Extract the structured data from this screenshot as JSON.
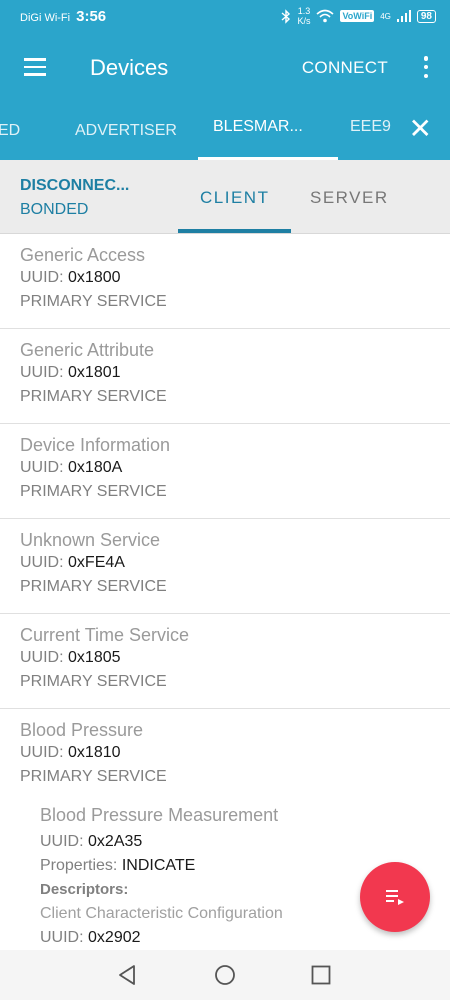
{
  "status_bar": {
    "carrier": "DiGi Wi-Fi",
    "time": "3:56",
    "speed_value": "1.3",
    "speed_unit": "K/s",
    "vowifi": "VoWiFi",
    "network": "4G",
    "battery": "98"
  },
  "app_bar": {
    "title": "Devices",
    "connect_label": "CONNECT"
  },
  "tabs": {
    "items": [
      "ED",
      "ADVERTISER",
      "BLESMAR...",
      "EEE9"
    ],
    "active_index": 2
  },
  "device": {
    "state": "DISCONNEC...",
    "bond": "BONDED"
  },
  "subtabs": {
    "client": "CLIENT",
    "server": "SERVER"
  },
  "services": [
    {
      "name": "Generic Access",
      "uuid_label": "UUID:",
      "uuid": "0x1800",
      "type": "PRIMARY SERVICE"
    },
    {
      "name": "Generic Attribute",
      "uuid_label": "UUID:",
      "uuid": "0x1801",
      "type": "PRIMARY SERVICE"
    },
    {
      "name": "Device Information",
      "uuid_label": "UUID:",
      "uuid": "0x180A",
      "type": "PRIMARY SERVICE"
    },
    {
      "name": "Unknown Service",
      "uuid_label": "UUID:",
      "uuid": "0xFE4A",
      "type": "PRIMARY SERVICE"
    },
    {
      "name": "Current Time Service",
      "uuid_label": "UUID:",
      "uuid": "0x1805",
      "type": "PRIMARY SERVICE"
    },
    {
      "name": "Blood Pressure",
      "uuid_label": "UUID:",
      "uuid": "0x1810",
      "type": "PRIMARY SERVICE"
    }
  ],
  "characteristic": {
    "name": "Blood Pressure Measurement",
    "uuid_label": "UUID:",
    "uuid": "0x2A35",
    "properties_label": "Properties:",
    "properties": "INDICATE",
    "descriptors_label": "Descriptors:",
    "descriptor_name": "Client Characteristic Configuration",
    "descriptor_uuid_label": "UUID:",
    "descriptor_uuid": "0x2902"
  },
  "colors": {
    "primary": "#2ba5cb",
    "accent_text": "#1e7fa3",
    "fab": "#f2384f"
  },
  "icons": {
    "menu": "hamburger-menu-icon",
    "overflow": "more-vertical-icon",
    "close": "close-icon",
    "fab": "log-list-icon",
    "back": "nav-back-icon",
    "home": "nav-home-icon",
    "recents": "nav-recents-icon"
  }
}
